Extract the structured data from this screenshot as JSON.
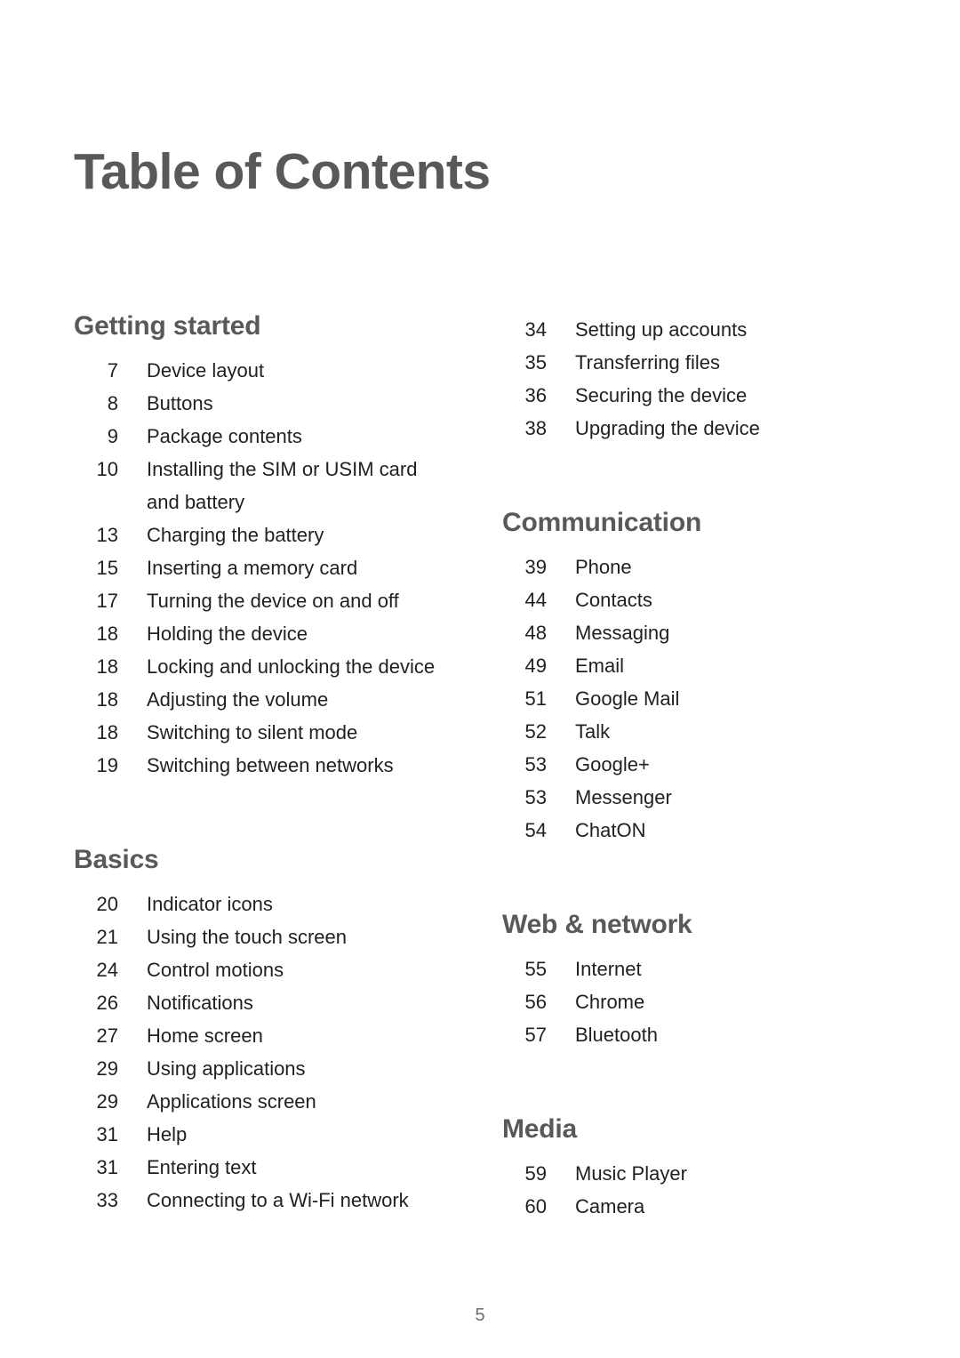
{
  "document": {
    "title": "Table of Contents",
    "page_number": "5",
    "text_color": "#231f20",
    "heading_color": "#58595b"
  },
  "columns": {
    "left": [
      {
        "heading": "Getting started",
        "has_heading": true,
        "entries": [
          {
            "page": "7",
            "label": "Device layout"
          },
          {
            "page": "8",
            "label": "Buttons"
          },
          {
            "page": "9",
            "label": "Package contents"
          },
          {
            "page": "10",
            "label": "Installing the SIM or USIM card and battery"
          },
          {
            "page": "13",
            "label": "Charging the battery"
          },
          {
            "page": "15",
            "label": "Inserting a memory card"
          },
          {
            "page": "17",
            "label": "Turning the device on and off"
          },
          {
            "page": "18",
            "label": "Holding the device"
          },
          {
            "page": "18",
            "label": "Locking and unlocking the device"
          },
          {
            "page": "18",
            "label": "Adjusting the volume"
          },
          {
            "page": "18",
            "label": "Switching to silent mode"
          },
          {
            "page": "19",
            "label": "Switching between networks"
          }
        ]
      },
      {
        "heading": "Basics",
        "has_heading": true,
        "entries": [
          {
            "page": "20",
            "label": "Indicator icons"
          },
          {
            "page": "21",
            "label": "Using the touch screen"
          },
          {
            "page": "24",
            "label": "Control motions"
          },
          {
            "page": "26",
            "label": "Notifications"
          },
          {
            "page": "27",
            "label": "Home screen"
          },
          {
            "page": "29",
            "label": "Using applications"
          },
          {
            "page": "29",
            "label": "Applications screen"
          },
          {
            "page": "31",
            "label": "Help"
          },
          {
            "page": "31",
            "label": "Entering text"
          },
          {
            "page": "33",
            "label": "Connecting to a Wi-Fi network"
          }
        ]
      }
    ],
    "right": [
      {
        "heading": "",
        "has_heading": false,
        "entries": [
          {
            "page": "34",
            "label": "Setting up accounts"
          },
          {
            "page": "35",
            "label": "Transferring files"
          },
          {
            "page": "36",
            "label": "Securing the device"
          },
          {
            "page": "38",
            "label": "Upgrading the device"
          }
        ]
      },
      {
        "heading": "Communication",
        "has_heading": true,
        "entries": [
          {
            "page": "39",
            "label": "Phone"
          },
          {
            "page": "44",
            "label": "Contacts"
          },
          {
            "page": "48",
            "label": "Messaging"
          },
          {
            "page": "49",
            "label": "Email"
          },
          {
            "page": "51",
            "label": "Google Mail"
          },
          {
            "page": "52",
            "label": "Talk"
          },
          {
            "page": "53",
            "label": "Google+"
          },
          {
            "page": "53",
            "label": "Messenger"
          },
          {
            "page": "54",
            "label": "ChatON"
          }
        ]
      },
      {
        "heading": "Web & network",
        "has_heading": true,
        "entries": [
          {
            "page": "55",
            "label": "Internet"
          },
          {
            "page": "56",
            "label": "Chrome"
          },
          {
            "page": "57",
            "label": "Bluetooth"
          }
        ]
      },
      {
        "heading": "Media",
        "has_heading": true,
        "entries": [
          {
            "page": "59",
            "label": "Music Player"
          },
          {
            "page": "60",
            "label": "Camera"
          }
        ]
      }
    ]
  }
}
